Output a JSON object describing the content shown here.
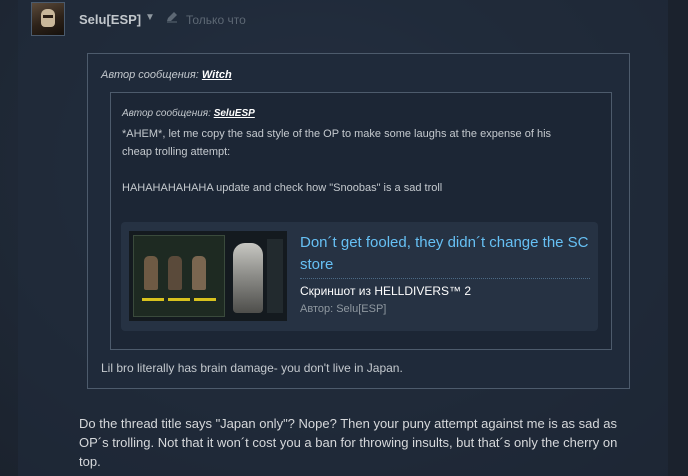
{
  "post": {
    "author": "Selu[ESP]",
    "timestamp": "Только что",
    "icons": {
      "avatar": "avatar",
      "author_menu": "chevron-down-icon",
      "edited": "pencil-icon"
    }
  },
  "quote_outer": {
    "prefix": "Автор сообщения:",
    "author": "Witch",
    "text": "Lil bro literally has brain damage- you don't live in Japan."
  },
  "quote_inner": {
    "prefix": "Автор сообщения:",
    "author": "SeluESP",
    "line1": "*AHEM*, let me copy the sad style of the OP to make some laughs at the expense of his",
    "line2": "cheap trolling attempt:",
    "line3": "HAHAHAHAHAHA update and check how \"Snoobas\" is a sad troll"
  },
  "screenshot_card": {
    "title": "Don´t get fooled, they didn´t change the SC store",
    "subtitle": "Скриншот из HELLDIVERS™ 2",
    "byline_prefix": "Автор:",
    "byline_author": "Selu[ESP]"
  },
  "reply": {
    "text": "Do the thread title says \"Japan only\"? Nope? Then your puny attempt against me is as sad as OP´s trolling. Not that it won´t cost you a ban for throwing insults, but that´s only the cherry on top."
  },
  "colors": {
    "link": "#66c0f4",
    "background": "#1e2633",
    "quote_border": "#4d5b6c"
  }
}
